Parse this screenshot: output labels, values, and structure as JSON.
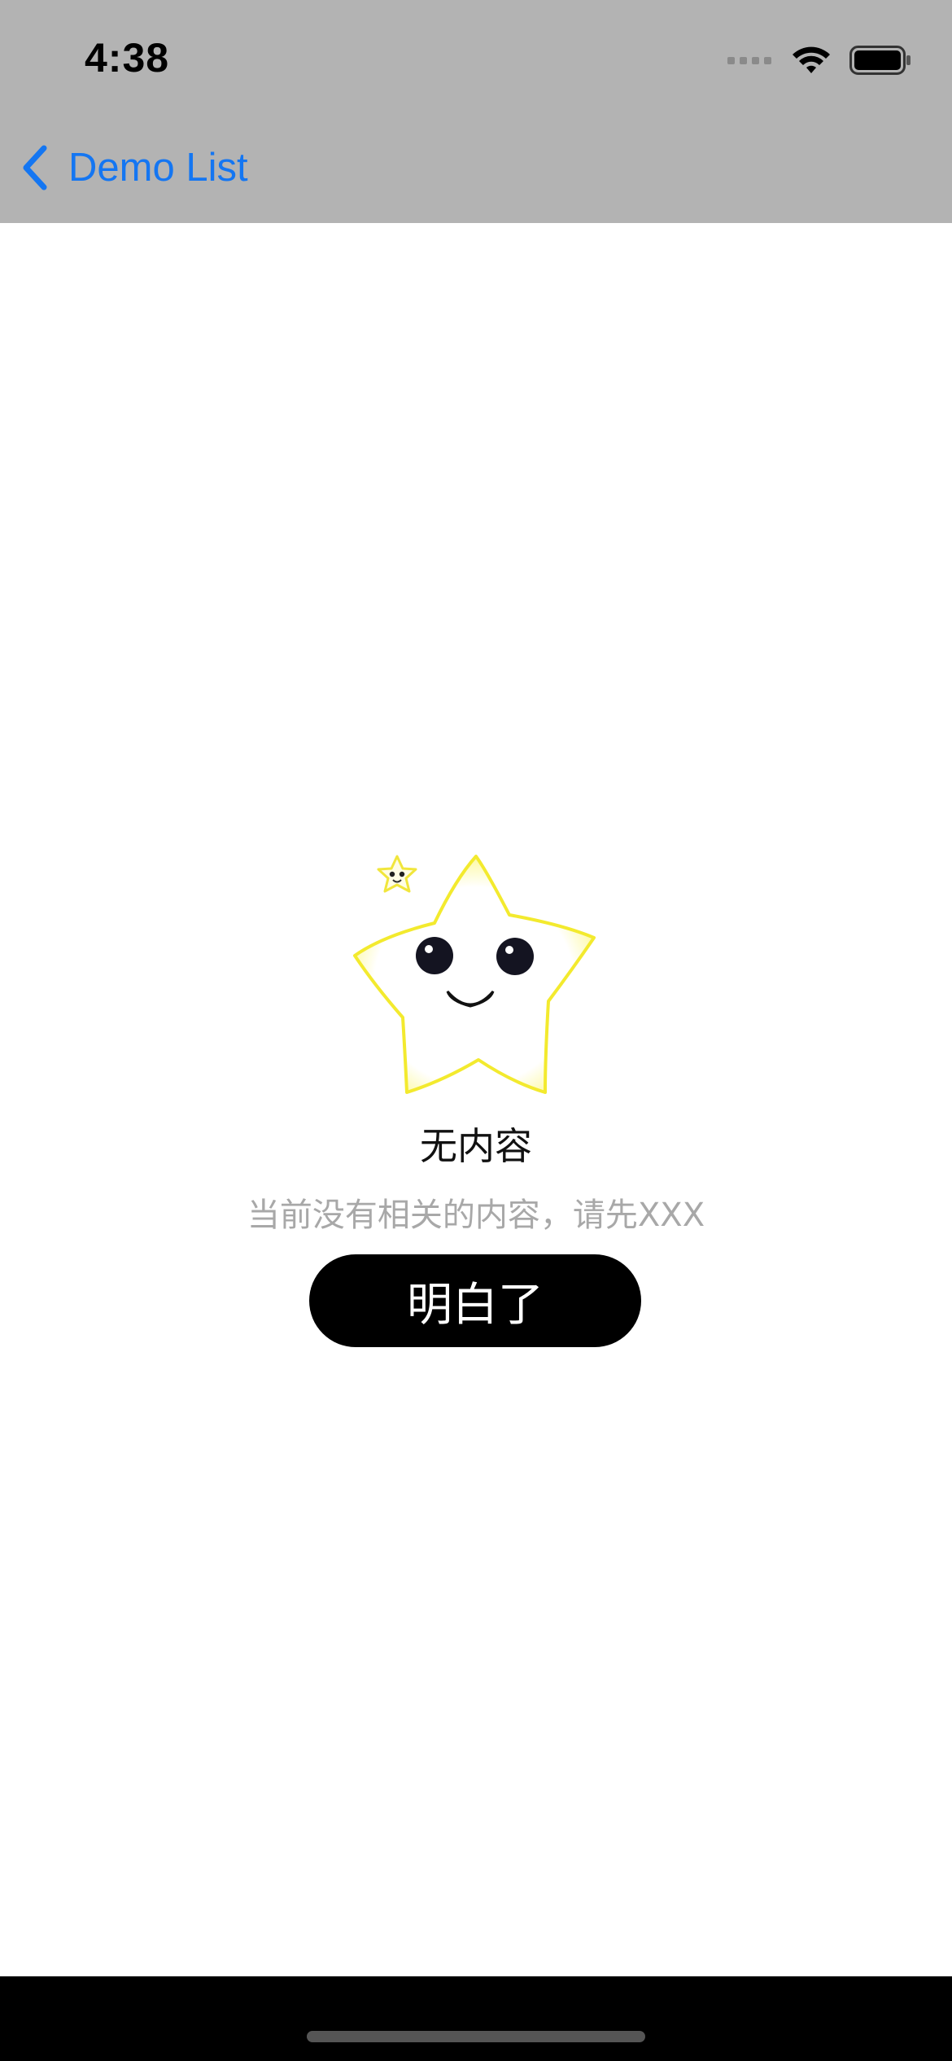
{
  "status_bar": {
    "time": "4:38",
    "icons": [
      "cellular-signal-icon",
      "wifi-icon",
      "battery-icon"
    ]
  },
  "nav_bar": {
    "back_label": "Demo List",
    "back_icon": "chevron-left-icon",
    "accent_color": "#1476f2",
    "background_color": "#b3b3b3"
  },
  "empty_state": {
    "illustration": "smiling-star-icon",
    "title": "无内容",
    "subtitle": "当前没有相关的内容，请先XXX",
    "button_label": "明白了"
  }
}
